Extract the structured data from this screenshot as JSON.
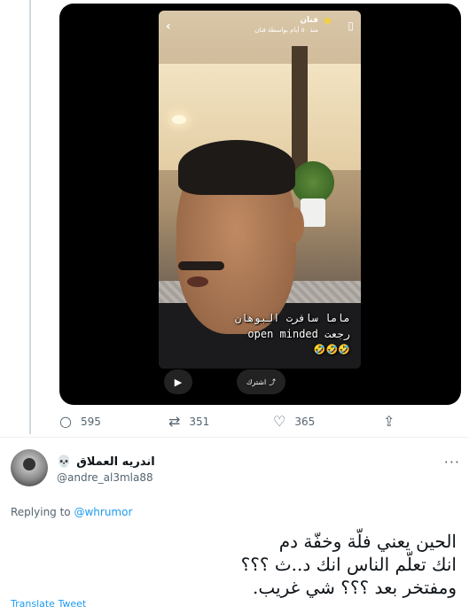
{
  "video": {
    "back_icon": "chevron-left-icon",
    "account_name": "فنان",
    "account_sub": "منذ ٥٠ أيام بواسطة فنان",
    "share_icon": "bookmark-icon",
    "caption_line1": "ماما سافرت البوهان",
    "caption_line2": "رجعت open minded",
    "caption_line3": "🤣🤣🤣",
    "play_icon": "play-icon",
    "share_button_label": "اشترك",
    "share_button_icon": "share-icon"
  },
  "actions": {
    "reply_count": "595",
    "retweet_count": "351",
    "like_count": "365"
  },
  "reply": {
    "display_name": "اندريه العملاق",
    "emoji": "💀",
    "handle": "@andre_al3mla88",
    "more_label": "···",
    "replying_to_prefix": "Replying to ",
    "replying_to_handle": "@whrumor",
    "text_line1": "الحين يعني فلّة وخفّة دم",
    "text_line2": "انك تعلّم الناس انك د..ث ؟؟؟",
    "text_line3": "ومفتخر بعد ؟؟؟ شي غريب.",
    "translate_label": "Translate Tweet"
  },
  "colors": {
    "link": "#1d9bf0",
    "muted": "#536471",
    "text": "#0f1419"
  }
}
